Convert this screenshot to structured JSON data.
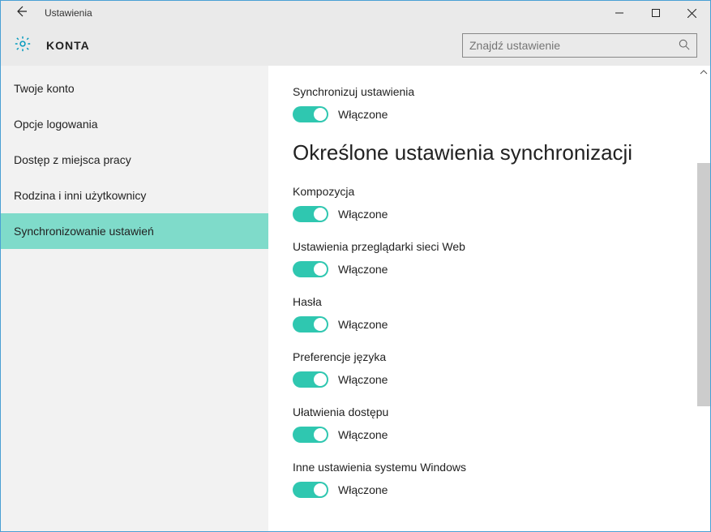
{
  "window": {
    "title": "Ustawienia"
  },
  "header": {
    "title": "KONTA",
    "search_placeholder": "Znajdź ustawienie"
  },
  "sidebar": {
    "items": [
      {
        "label": "Twoje konto",
        "selected": false
      },
      {
        "label": "Opcje logowania",
        "selected": false
      },
      {
        "label": "Dostęp z miejsca pracy",
        "selected": false
      },
      {
        "label": "Rodzina i inni użytkownicy",
        "selected": false
      },
      {
        "label": "Synchronizowanie ustawień",
        "selected": true
      }
    ]
  },
  "content": {
    "top_setting": {
      "label": "Synchronizuj ustawienia",
      "state": "Włączone",
      "on": true
    },
    "section_heading": "Określone ustawienia synchronizacji",
    "settings": [
      {
        "label": "Kompozycja",
        "state": "Włączone",
        "on": true
      },
      {
        "label": "Ustawienia przeglądarki sieci Web",
        "state": "Włączone",
        "on": true
      },
      {
        "label": "Hasła",
        "state": "Włączone",
        "on": true
      },
      {
        "label": "Preferencje języka",
        "state": "Włączone",
        "on": true
      },
      {
        "label": "Ułatwienia dostępu",
        "state": "Włączone",
        "on": true
      },
      {
        "label": "Inne ustawienia systemu Windows",
        "state": "Włączone",
        "on": true
      }
    ]
  }
}
